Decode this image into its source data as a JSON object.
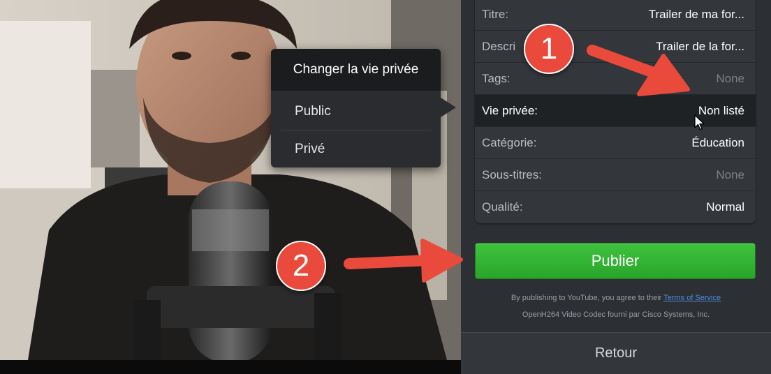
{
  "properties": {
    "rows": [
      {
        "label": "Titre:",
        "value": "Trailer de ma for...",
        "dim": false
      },
      {
        "label": "Descri",
        "value": "Trailer de la for...",
        "dim": false
      },
      {
        "label": "Tags:",
        "value": "None",
        "dim": true
      },
      {
        "label": "Vie privée:",
        "value": "Non listé",
        "dim": false
      },
      {
        "label": "Catégorie:",
        "value": "Éducation",
        "dim": false
      },
      {
        "label": "Sous-titres:",
        "value": "None",
        "dim": true
      },
      {
        "label": "Qualité:",
        "value": "Normal",
        "dim": false
      }
    ]
  },
  "popover": {
    "title": "Changer la vie privée",
    "options": [
      "Public",
      "Privé"
    ]
  },
  "publish": {
    "label": "Publier"
  },
  "legal": {
    "line1_prefix": "By publishing to YouTube, you agree to their ",
    "line1_link": "Terms of Service",
    "line2": "OpenH264 Video Codec fourni par Cisco Systems, Inc."
  },
  "back": {
    "label": "Retour"
  },
  "annotations": {
    "badge1": "1",
    "badge2": "2"
  },
  "colors": {
    "accent_green": "#2aa42b",
    "annotation_red": "#ea4a3b",
    "link_blue": "#4a90e2",
    "panel_bg": "#2c2f33"
  },
  "icons": [
    "mouse-pointer-icon",
    "popover-arrow-icon",
    "annotation-arrow-icon"
  ]
}
